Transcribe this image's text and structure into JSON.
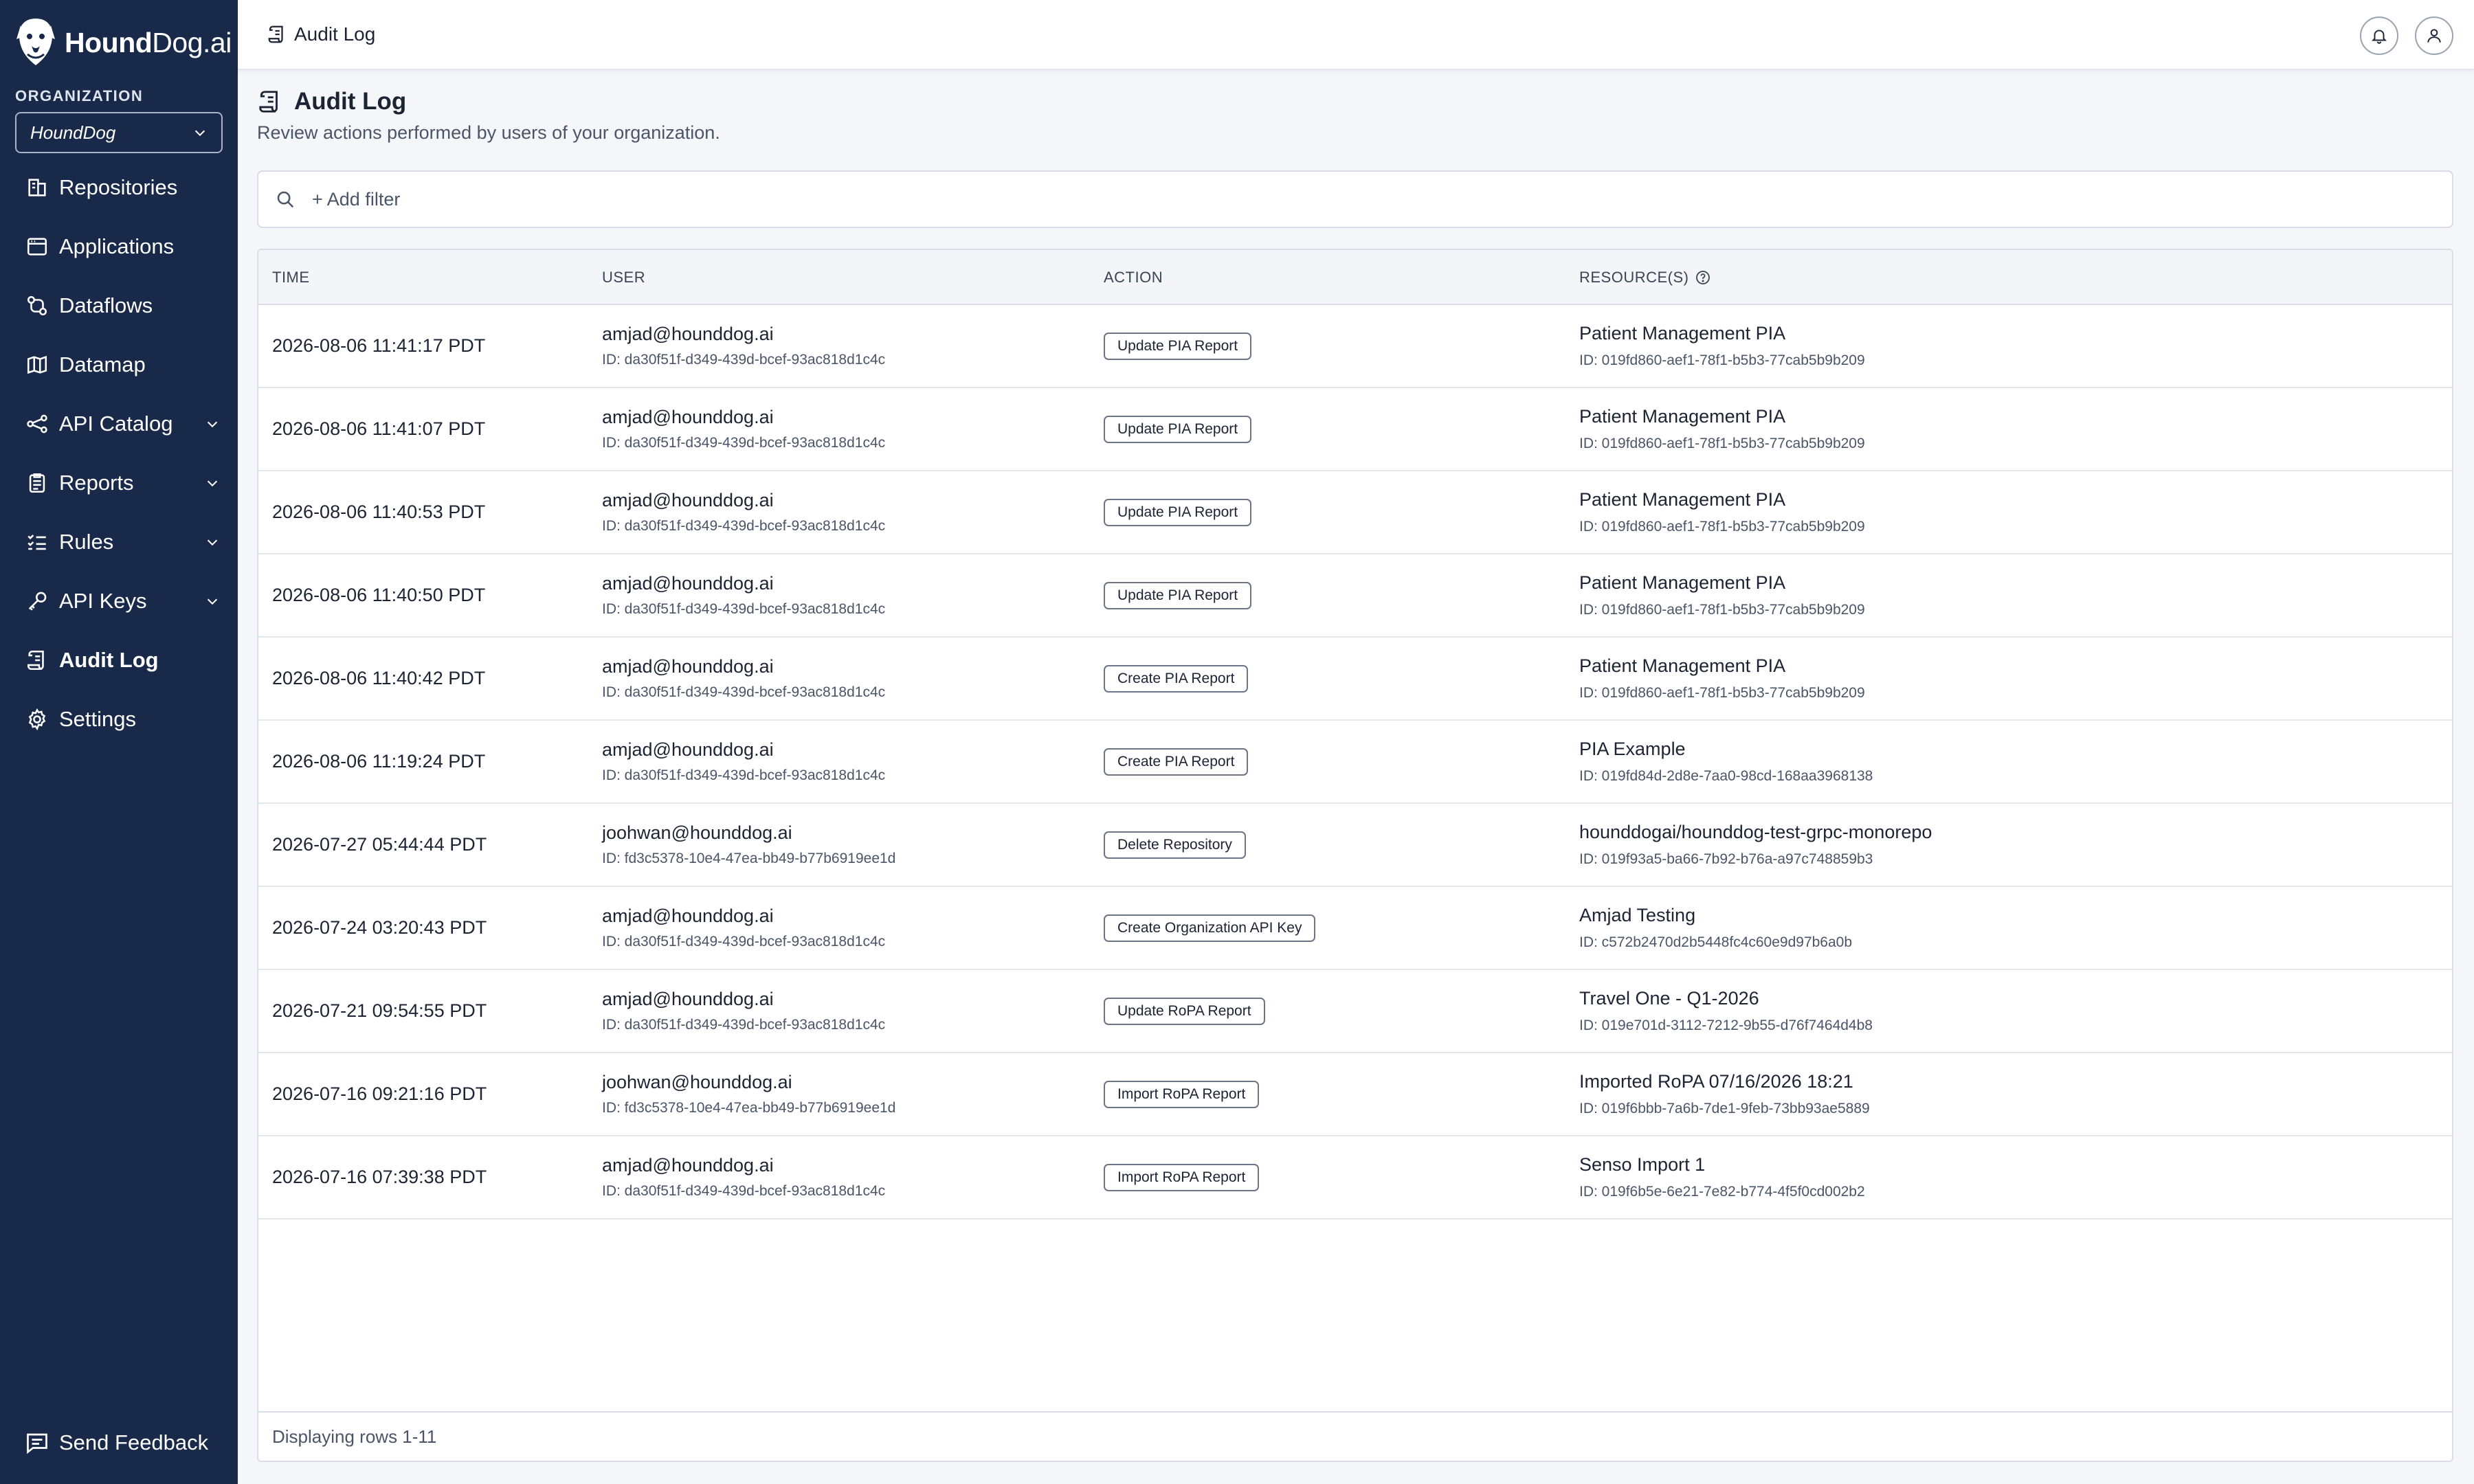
{
  "brand": {
    "name_bold": "Hound",
    "name_rest": "Dog.ai"
  },
  "organization": {
    "label": "ORGANIZATION",
    "selected": "HoundDog"
  },
  "nav": [
    {
      "label": "Repositories",
      "icon": "repository-icon",
      "chevron": false,
      "active": false
    },
    {
      "label": "Applications",
      "icon": "window-icon",
      "chevron": false,
      "active": false
    },
    {
      "label": "Dataflows",
      "icon": "dataflow-icon",
      "chevron": false,
      "active": false
    },
    {
      "label": "Datamap",
      "icon": "map-icon",
      "chevron": false,
      "active": false
    },
    {
      "label": "API Catalog",
      "icon": "api-catalog-icon",
      "chevron": true,
      "active": false
    },
    {
      "label": "Reports",
      "icon": "clipboard-icon",
      "chevron": true,
      "active": false
    },
    {
      "label": "Rules",
      "icon": "checklist-icon",
      "chevron": true,
      "active": false
    },
    {
      "label": "API Keys",
      "icon": "key-icon",
      "chevron": true,
      "active": false
    },
    {
      "label": "Audit Log",
      "icon": "audit-log-icon",
      "chevron": false,
      "active": true
    },
    {
      "label": "Settings",
      "icon": "gear-icon",
      "chevron": false,
      "active": false
    }
  ],
  "feedback": {
    "label": "Send Feedback"
  },
  "topbar": {
    "breadcrumb": "Audit Log"
  },
  "page": {
    "title": "Audit Log",
    "subtitle": "Review actions performed by users of your organization.",
    "filter_placeholder": "+ Add filter"
  },
  "table": {
    "headers": {
      "time": "TIME",
      "user": "USER",
      "action": "ACTION",
      "resources": "RESOURCE(S)"
    },
    "rows": [
      {
        "time": "2026-08-06 11:41:17 PDT",
        "user": "amjad@hounddog.ai",
        "user_id": "ID: da30f51f-d349-439d-bcef-93ac818d1c4c",
        "action": "Update PIA Report",
        "resource": "Patient Management PIA",
        "resource_id": "ID: 019fd860-aef1-78f1-b5b3-77cab5b9b209"
      },
      {
        "time": "2026-08-06 11:41:07 PDT",
        "user": "amjad@hounddog.ai",
        "user_id": "ID: da30f51f-d349-439d-bcef-93ac818d1c4c",
        "action": "Update PIA Report",
        "resource": "Patient Management PIA",
        "resource_id": "ID: 019fd860-aef1-78f1-b5b3-77cab5b9b209"
      },
      {
        "time": "2026-08-06 11:40:53 PDT",
        "user": "amjad@hounddog.ai",
        "user_id": "ID: da30f51f-d349-439d-bcef-93ac818d1c4c",
        "action": "Update PIA Report",
        "resource": "Patient Management PIA",
        "resource_id": "ID: 019fd860-aef1-78f1-b5b3-77cab5b9b209"
      },
      {
        "time": "2026-08-06 11:40:50 PDT",
        "user": "amjad@hounddog.ai",
        "user_id": "ID: da30f51f-d349-439d-bcef-93ac818d1c4c",
        "action": "Update PIA Report",
        "resource": "Patient Management PIA",
        "resource_id": "ID: 019fd860-aef1-78f1-b5b3-77cab5b9b209"
      },
      {
        "time": "2026-08-06 11:40:42 PDT",
        "user": "amjad@hounddog.ai",
        "user_id": "ID: da30f51f-d349-439d-bcef-93ac818d1c4c",
        "action": "Create PIA Report",
        "resource": "Patient Management PIA",
        "resource_id": "ID: 019fd860-aef1-78f1-b5b3-77cab5b9b209"
      },
      {
        "time": "2026-08-06 11:19:24 PDT",
        "user": "amjad@hounddog.ai",
        "user_id": "ID: da30f51f-d349-439d-bcef-93ac818d1c4c",
        "action": "Create PIA Report",
        "resource": "PIA Example",
        "resource_id": "ID: 019fd84d-2d8e-7aa0-98cd-168aa3968138"
      },
      {
        "time": "2026-07-27 05:44:44 PDT",
        "user": "joohwan@hounddog.ai",
        "user_id": "ID: fd3c5378-10e4-47ea-bb49-b77b6919ee1d",
        "action": "Delete Repository",
        "resource": "hounddogai/hounddog-test-grpc-monorepo",
        "resource_id": "ID: 019f93a5-ba66-7b92-b76a-a97c748859b3"
      },
      {
        "time": "2026-07-24 03:20:43 PDT",
        "user": "amjad@hounddog.ai",
        "user_id": "ID: da30f51f-d349-439d-bcef-93ac818d1c4c",
        "action": "Create Organization API Key",
        "resource": "Amjad Testing",
        "resource_id": "ID: c572b2470d2b5448fc4c60e9d97b6a0b"
      },
      {
        "time": "2026-07-21 09:54:55 PDT",
        "user": "amjad@hounddog.ai",
        "user_id": "ID: da30f51f-d349-439d-bcef-93ac818d1c4c",
        "action": "Update RoPA Report",
        "resource": "Travel One - Q1-2026",
        "resource_id": "ID: 019e701d-3112-7212-9b55-d76f7464d4b8"
      },
      {
        "time": "2026-07-16 09:21:16 PDT",
        "user": "joohwan@hounddog.ai",
        "user_id": "ID: fd3c5378-10e4-47ea-bb49-b77b6919ee1d",
        "action": "Import RoPA Report",
        "resource": "Imported RoPA 07/16/2026 18:21",
        "resource_id": "ID: 019f6bbb-7a6b-7de1-9feb-73bb93ae5889"
      },
      {
        "time": "2026-07-16 07:39:38 PDT",
        "user": "amjad@hounddog.ai",
        "user_id": "ID: da30f51f-d349-439d-bcef-93ac818d1c4c",
        "action": "Import RoPA Report",
        "resource": "Senso Import 1",
        "resource_id": "ID: 019f6b5e-6e21-7e82-b774-4f5f0cd002b2"
      }
    ],
    "footer": "Displaying rows 1-11"
  },
  "colors": {
    "sidebar_bg": "#18294a",
    "page_bg": "#f4f6f9",
    "text": "#1c2434"
  }
}
